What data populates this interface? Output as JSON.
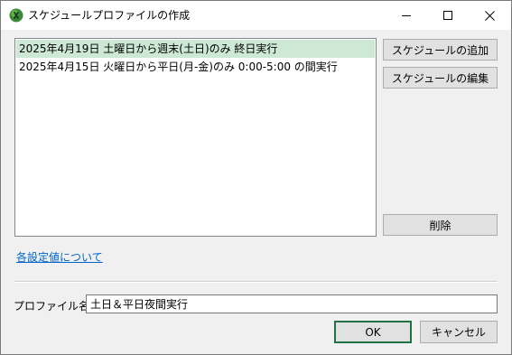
{
  "window": {
    "title": "スケジュールプロファイルの作成",
    "icon": "excel-x-icon",
    "controls": {
      "minimize": "minimize-icon",
      "maximize": "maximize-icon",
      "close": "close-icon"
    }
  },
  "schedule_list": {
    "items": [
      {
        "label": "2025年4月19日 土曜日から週末(土日)のみ 終日実行",
        "selected": true
      },
      {
        "label": "2025年4月15日 火曜日から平日(月-金)のみ 0:00-5:00 の間実行",
        "selected": false
      }
    ]
  },
  "side_buttons": {
    "add": "スケジュールの追加",
    "edit": "スケジュールの編集",
    "delete": "削除"
  },
  "help_link": "各設定値について",
  "profile_name": {
    "label": "プロファイル名",
    "value": "土日＆平日夜間実行"
  },
  "footer": {
    "ok": "OK",
    "cancel": "キャンセル"
  },
  "colors": {
    "accent": "#217346",
    "selection": "#cde8d5",
    "link": "#0066cc"
  }
}
